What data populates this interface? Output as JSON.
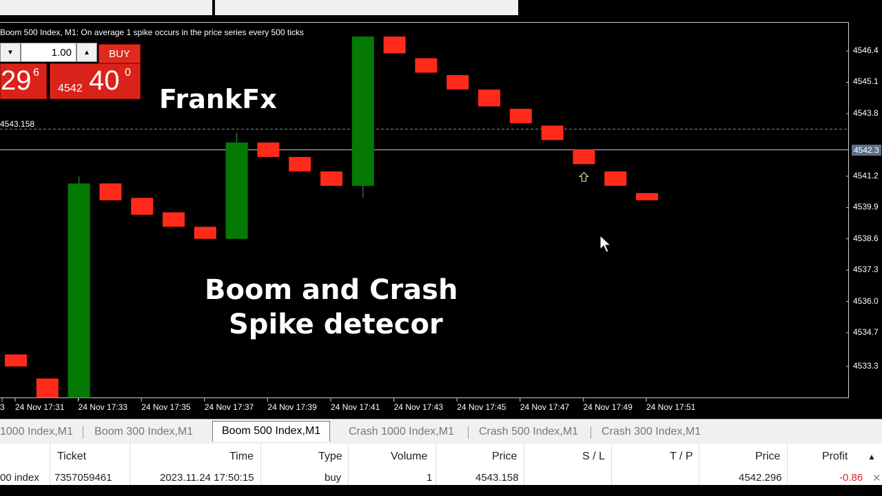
{
  "chart": {
    "title": "Boom 500 Index, M1:  On average 1 spike occurs in the price series every 500 ticks",
    "reference_price_label": "4543.158",
    "current_price_label": "4542.3",
    "price_axis": [
      "4546.4",
      "4545.1",
      "4543.8",
      "4541.2",
      "4539.9",
      "4538.6",
      "4537.3",
      "4536.0",
      "4534.7",
      "4533.3"
    ],
    "time_axis": [
      "3",
      "24 Nov 17:31",
      "24 Nov 17:33",
      "24 Nov 17:35",
      "24 Nov 17:37",
      "24 Nov 17:39",
      "24 Nov 17:41",
      "24 Nov 17:43",
      "24 Nov 17:45",
      "24 Nov 17:47",
      "24 Nov 17:49",
      "24 Nov 17:51"
    ],
    "colors": {
      "bear": "#ff2a1a",
      "bull": "#047a04",
      "background": "#000000"
    },
    "signal_icon": "up-arrow-icon"
  },
  "overlay": {
    "brand": "FrankFx",
    "headline_line1": "Boom and Crash",
    "headline_line2": "Spike detecor"
  },
  "trade_panel": {
    "volume": "1.00",
    "buy_label": "BUY",
    "sell_big": "29",
    "sell_sup": "6",
    "buy_small": "4542",
    "buy_big": "40",
    "buy_sup": "0"
  },
  "tabs": [
    {
      "label": "1000 Index,M1"
    },
    {
      "label": "Boom 300 Index,M1"
    },
    {
      "label": "Boom 500 Index,M1",
      "active": true
    },
    {
      "label": "Crash 1000 Index,M1"
    },
    {
      "label": "Crash 500 Index,M1"
    },
    {
      "label": "Crash 300 Index,M1"
    }
  ],
  "table": {
    "headers": [
      "Ticket",
      "Time",
      "Type",
      "Volume",
      "Price",
      "S / L",
      "T / P",
      "Price",
      "Profit"
    ],
    "row": {
      "symbol": "00 index",
      "ticket": "7357059461",
      "time": "2023.11.24 17:50:15",
      "type": "buy",
      "volume": "1",
      "price": "4543.158",
      "sl": "",
      "tp": "",
      "current_price": "4542.296",
      "profit": "-0.86"
    },
    "profit_color": "#e02020"
  },
  "chart_data": {
    "type": "candlestick",
    "y_unit": "price",
    "ylim": [
      4532.6,
      4547.2
    ],
    "candles": [
      {
        "open": 4533.8,
        "close": 4533.3
      },
      {
        "open": 4532.8,
        "close": 4532.0
      },
      {
        "open": 4532.0,
        "close": 4540.9,
        "high": 4541.2,
        "low": 4531.9
      },
      {
        "open": 4540.9,
        "close": 4540.2
      },
      {
        "open": 4540.3,
        "close": 4539.6
      },
      {
        "open": 4539.7,
        "close": 4539.1
      },
      {
        "open": 4539.1,
        "close": 4538.6
      },
      {
        "open": 4538.6,
        "close": 4542.6,
        "high": 4543.0
      },
      {
        "open": 4542.6,
        "close": 4542.0
      },
      {
        "open": 4542.0,
        "close": 4541.4
      },
      {
        "open": 4541.4,
        "close": 4540.8
      },
      {
        "open": 4540.8,
        "close": 4547.0,
        "low": 4540.3
      },
      {
        "open": 4547.0,
        "close": 4546.3
      },
      {
        "open": 4546.1,
        "close": 4545.5
      },
      {
        "open": 4545.4,
        "close": 4544.8
      },
      {
        "open": 4544.8,
        "close": 4544.1
      },
      {
        "open": 4544.0,
        "close": 4543.4
      },
      {
        "open": 4543.3,
        "close": 4542.7
      },
      {
        "open": 4542.3,
        "close": 4541.7
      },
      {
        "open": 4541.4,
        "close": 4540.8
      },
      {
        "open": 4540.5,
        "close": 4540.2
      }
    ],
    "reference_line": 4543.158,
    "current_price": 4542.296,
    "signal": {
      "candle_index": 18,
      "direction": "up"
    }
  }
}
